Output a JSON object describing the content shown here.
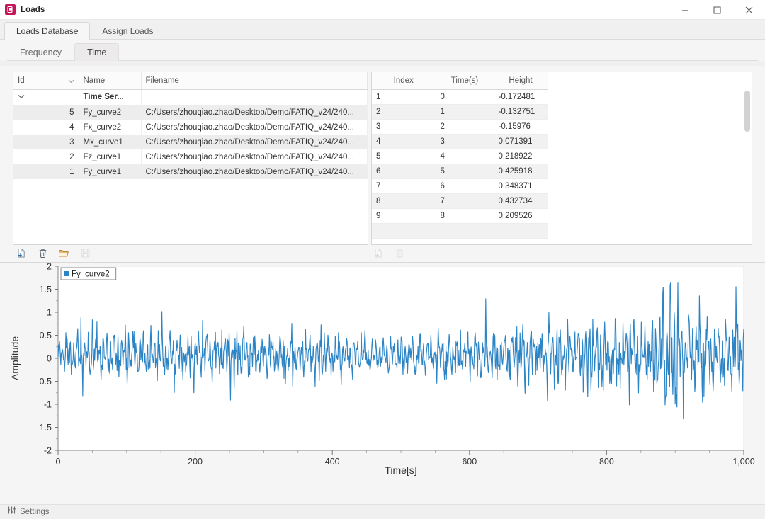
{
  "window": {
    "title": "Loads",
    "app_icon": "app-icon",
    "minimize_label": "Minimize",
    "maximize_label": "Maximize",
    "close_label": "Close"
  },
  "outer_tabs": [
    {
      "label": "Loads Database",
      "active": true
    },
    {
      "label": "Assign Loads",
      "active": false
    }
  ],
  "inner_tabs": [
    {
      "label": "Frequency",
      "active": false
    },
    {
      "label": "Time",
      "active": true
    }
  ],
  "loads_table": {
    "columns": [
      "Id",
      "Name",
      "Filename"
    ],
    "group_row": {
      "label": "Time Ser..."
    },
    "rows": [
      {
        "id": "5",
        "name": "Fy_curve2",
        "filename": "C:/Users/zhouqiao.zhao/Desktop/Demo/FATIQ_v24/240..."
      },
      {
        "id": "4",
        "name": "Fx_curve2",
        "filename": "C:/Users/zhouqiao.zhao/Desktop/Demo/FATIQ_v24/240..."
      },
      {
        "id": "3",
        "name": "Mx_curve1",
        "filename": "C:/Users/zhouqiao.zhao/Desktop/Demo/FATIQ_v24/240..."
      },
      {
        "id": "2",
        "name": "Fz_curve1",
        "filename": "C:/Users/zhouqiao.zhao/Desktop/Demo/FATIQ_v24/240..."
      },
      {
        "id": "1",
        "name": "Fy_curve1",
        "filename": "C:/Users/zhouqiao.zhao/Desktop/Demo/FATIQ_v24/240..."
      }
    ]
  },
  "data_table": {
    "columns": [
      "Index",
      "Time(s)",
      "Height"
    ],
    "rows": [
      {
        "index": "1",
        "time": "0",
        "height": "-0.172481"
      },
      {
        "index": "2",
        "time": "1",
        "height": "-0.132751"
      },
      {
        "index": "3",
        "time": "2",
        "height": "-0.15976"
      },
      {
        "index": "4",
        "time": "3",
        "height": "0.071391"
      },
      {
        "index": "5",
        "time": "4",
        "height": "0.218922"
      },
      {
        "index": "6",
        "time": "5",
        "height": "0.425918"
      },
      {
        "index": "7",
        "time": "6",
        "height": "0.348371"
      },
      {
        "index": "8",
        "time": "7",
        "height": "0.432734"
      },
      {
        "index": "9",
        "time": "8",
        "height": "0.209526"
      }
    ]
  },
  "left_toolbar": [
    {
      "icon": "add-row-icon",
      "enabled": true
    },
    {
      "icon": "delete-row-icon",
      "enabled": true
    },
    {
      "icon": "open-folder-icon",
      "enabled": true
    },
    {
      "icon": "save-icon",
      "enabled": false
    }
  ],
  "right_toolbar": [
    {
      "icon": "add-row-icon",
      "enabled": false
    },
    {
      "icon": "delete-row-icon",
      "enabled": false
    }
  ],
  "statusbar": {
    "settings_label": "Settings",
    "settings_icon": "sliders-icon"
  },
  "chart_data": {
    "type": "line",
    "title": "",
    "xlabel": "Time[s]",
    "ylabel": "Amplitude",
    "xlim": [
      0,
      1000
    ],
    "ylim": [
      -2,
      2
    ],
    "xticks": [
      0,
      200,
      400,
      600,
      800,
      1000
    ],
    "xticklabels": [
      "0",
      "200",
      "400",
      "600",
      "800",
      "1,000"
    ],
    "yticks": [
      -2,
      -1.5,
      -1,
      -0.5,
      0,
      0.5,
      1,
      1.5,
      2
    ],
    "yticklabels": [
      "-2",
      "-1.5",
      "-1",
      "-0.5",
      "0",
      "0.5",
      "1",
      "1.5",
      "2"
    ],
    "grid": false,
    "legend_position": "top-left",
    "series": [
      {
        "name": "Fy_curve2",
        "color": "#2b84c6",
        "description": "Noisy time-series load signal, amplitude mostly within -0.8 to 0.8 for t<700 growing to peaks near 1.6 and troughs near -1.7 around t=880-910",
        "values": [
          -0.172481,
          -0.132751,
          -0.15976,
          0.071391,
          0.218922,
          0.425918,
          0.348371,
          0.432734,
          0.209526,
          0.31,
          0.12,
          -0.3,
          0.28,
          0.35,
          -0.1,
          0.42,
          0.18,
          -0.52,
          0.3,
          0.46,
          0.21,
          -0.2,
          0.34,
          0.5,
          0.12,
          -0.45,
          0.3,
          0.55,
          0.08,
          -0.35,
          0.4,
          0.62,
          0.2,
          -0.28,
          0.36,
          0.44,
          0.02,
          -0.5,
          0.25,
          0.38,
          0.18,
          -0.15,
          0.3,
          0.55,
          0.1,
          -0.42,
          0.28,
          0.48,
          0.15,
          -0.55,
          0.33,
          0.52,
          0.05,
          -0.3,
          0.42,
          0.66,
          0.22,
          -0.38,
          0.3,
          0.5,
          0.12,
          -0.48,
          0.28,
          0.45,
          0.16,
          -0.2,
          0.35,
          0.58,
          0.1,
          -0.52,
          0.3,
          0.47,
          0.2,
          -0.35,
          0.38,
          0.6,
          0.05,
          -0.43,
          0.32,
          0.5
        ]
      }
    ]
  }
}
